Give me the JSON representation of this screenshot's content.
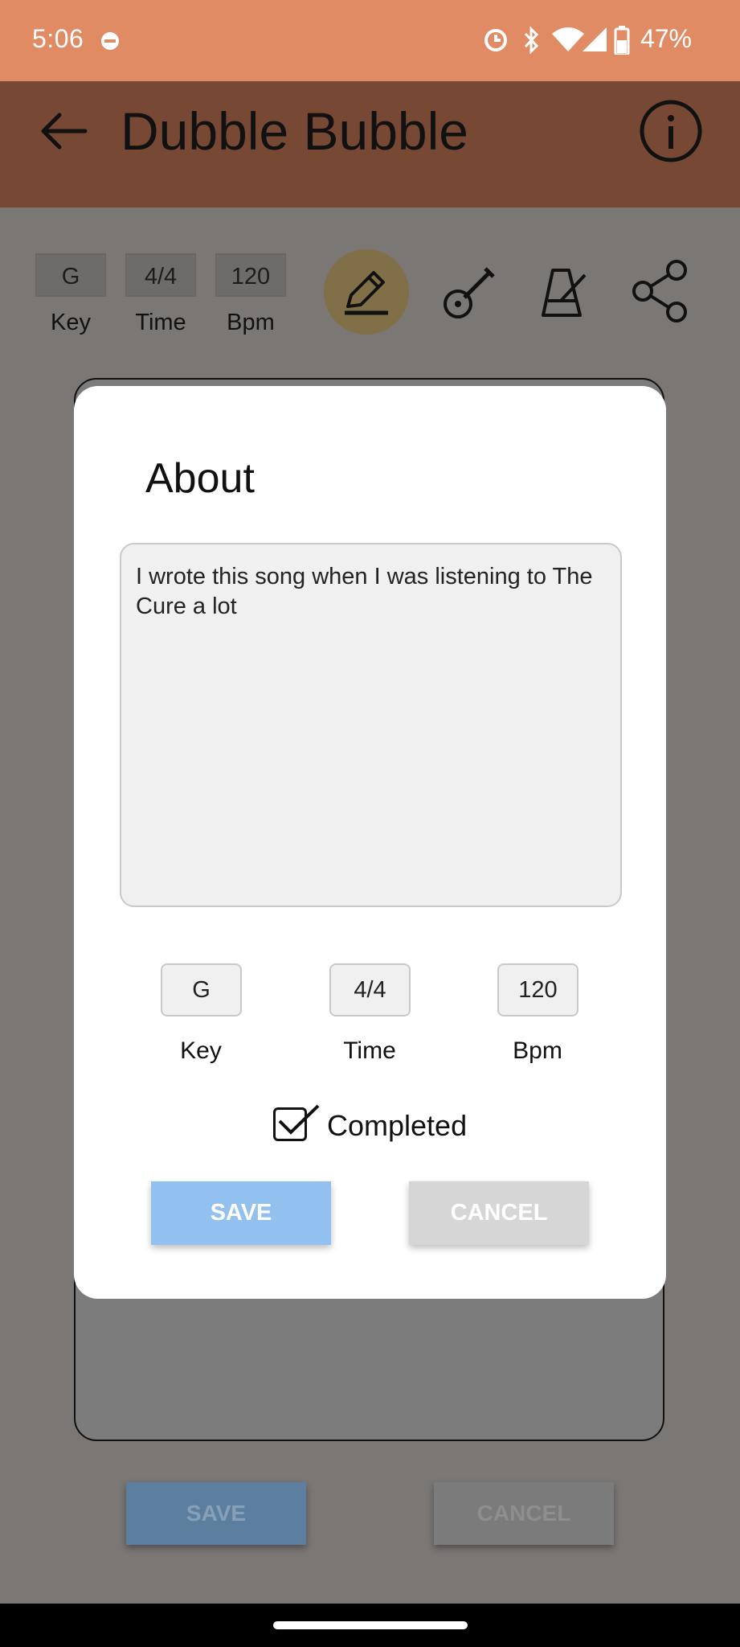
{
  "status_bar": {
    "time": "5:06",
    "battery": "47%",
    "icons": [
      "dnd-icon",
      "sync-icon",
      "bluetooth-icon",
      "wifi-icon",
      "signal-icon",
      "battery-icon"
    ]
  },
  "app_bar": {
    "title": "Dubble Bubble",
    "back_icon": "arrow-left-icon",
    "info_icon": "info-icon"
  },
  "song_header": {
    "key": "G",
    "time": "4/4",
    "bpm": "120",
    "key_label": "Key",
    "time_label": "Time",
    "bpm_label": "Bpm",
    "tools": [
      "pencil-icon",
      "guitar-icon",
      "metronome-icon",
      "share-icon"
    ]
  },
  "background_buttons": {
    "save": "SAVE",
    "cancel": "CANCEL"
  },
  "dialog": {
    "title": "About",
    "about_text": "I wrote this song when I was listening to The Cure a lot",
    "key_value": "G",
    "time_value": "4/4",
    "bpm_value": "120",
    "key_label": "Key",
    "time_label": "Time",
    "bpm_label": "Bpm",
    "completed_label": "Completed",
    "completed": true,
    "save_label": "SAVE",
    "cancel_label": "CANCEL"
  },
  "colors": {
    "status_bar": "#e08b64",
    "app_bar": "#774834",
    "save_button": "#93c1ef",
    "cancel_button": "#d6d6d6",
    "scrim": "#7b7775"
  }
}
